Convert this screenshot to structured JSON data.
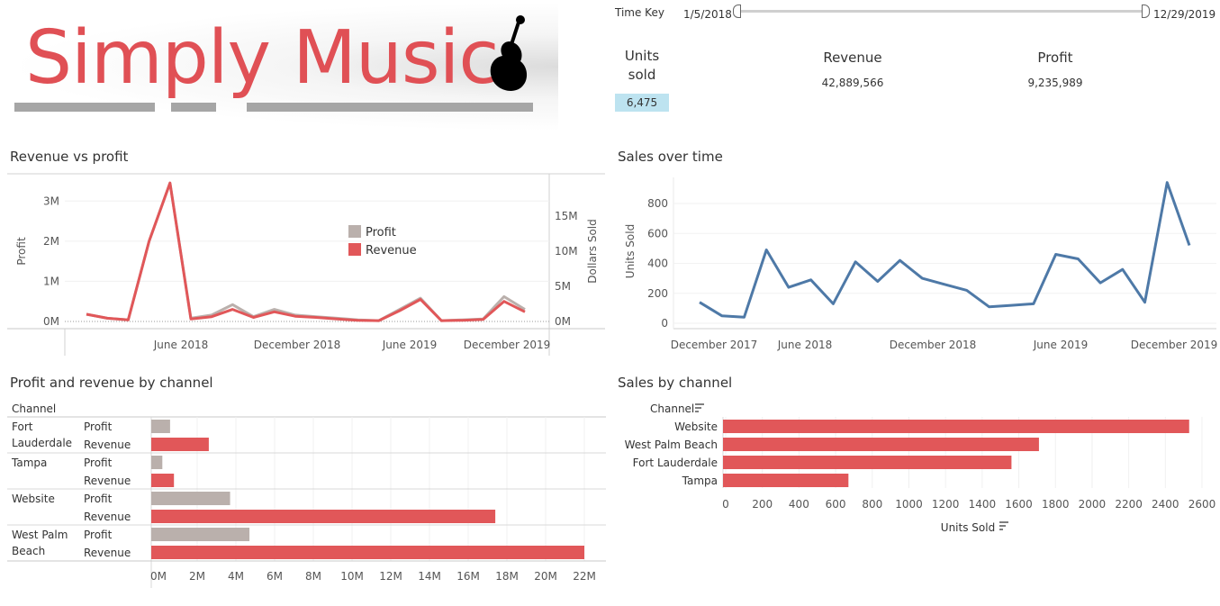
{
  "logo": {
    "text": "Simply Music",
    "icon": "violin-icon"
  },
  "time_filter": {
    "label": "Time Key",
    "start": "1/5/2018",
    "end": "12/29/2019"
  },
  "kpis": {
    "units": {
      "label_line1": "Units",
      "label_line2": "sold",
      "value": "6,475"
    },
    "revenue": {
      "label": "Revenue",
      "value": "42,889,566"
    },
    "profit": {
      "label": "Profit",
      "value": "9,235,989"
    }
  },
  "colors": {
    "revenue": "#e15759",
    "profit": "#bab0ac",
    "sales_line": "#4e79a7",
    "kpi_highlight": "#bde3f0"
  },
  "sheets": {
    "revenue_vs_profit": {
      "title": "Revenue vs profit"
    },
    "sales_over_time": {
      "title": "Sales over time"
    },
    "profit_revenue_by_channel": {
      "title": "Profit and revenue by channel"
    },
    "sales_by_channel": {
      "title": "Sales by channel"
    }
  },
  "chart_data": [
    {
      "type": "line",
      "title": "Revenue vs profit",
      "ylabel": "Profit",
      "y2label": "Dollars Sold",
      "yticks": [
        "0M",
        "1M",
        "2M",
        "3M"
      ],
      "y2ticks": [
        "0M",
        "5M",
        "10M",
        "15M"
      ],
      "xticks": [
        "June 2018",
        "December 2018",
        "June 2019",
        "December 2019"
      ],
      "ylim": [
        0,
        3.5
      ],
      "legend": {
        "position": "top-right",
        "entries": [
          "Profit",
          "Revenue"
        ]
      },
      "series": [
        {
          "name": "Profit",
          "values": [
            0.18,
            0.08,
            0.04,
            2.0,
            3.45,
            0.08,
            0.16,
            0.42,
            0.12,
            0.3,
            0.16,
            0.12,
            0.08,
            0.04,
            0.02,
            0.3,
            0.58,
            0.02,
            0.04,
            0.06,
            0.62,
            0.3
          ]
        },
        {
          "name": "Revenue",
          "values": [
            0.18,
            0.08,
            0.04,
            2.0,
            3.45,
            0.06,
            0.12,
            0.3,
            0.1,
            0.24,
            0.13,
            0.1,
            0.06,
            0.03,
            0.02,
            0.27,
            0.55,
            0.02,
            0.03,
            0.05,
            0.5,
            0.24
          ]
        }
      ]
    },
    {
      "type": "line",
      "title": "Sales over time",
      "ylabel": "Units Sold",
      "yticks": [
        "0",
        "200",
        "400",
        "600",
        "800"
      ],
      "xticks": [
        "December 2017",
        "June 2018",
        "December 2018",
        "June 2019",
        "December 2019"
      ],
      "ylim": [
        0,
        950
      ],
      "series": [
        {
          "name": "Units Sold",
          "values": [
            140,
            50,
            40,
            490,
            240,
            290,
            130,
            410,
            280,
            420,
            300,
            260,
            220,
            110,
            120,
            130,
            460,
            430,
            270,
            360,
            140,
            940,
            520
          ]
        }
      ]
    },
    {
      "type": "bar",
      "title": "Profit and revenue by channel",
      "channel_header": "Channel",
      "xticks": [
        "0M",
        "2M",
        "4M",
        "6M",
        "8M",
        "10M",
        "12M",
        "14M",
        "16M",
        "18M",
        "20M",
        "22M"
      ],
      "xlim": [
        0,
        22
      ],
      "rows": [
        {
          "channel_line1": "Fort",
          "channel_line2": "Lauderdale",
          "profit": 0.6,
          "revenue": 2.6
        },
        {
          "channel_line1": "Tampa",
          "channel_line2": "",
          "profit": 0.2,
          "revenue": 0.8
        },
        {
          "channel_line1": "Website",
          "channel_line2": "",
          "profit": 3.7,
          "revenue": 17.4
        },
        {
          "channel_line1": "West Palm",
          "channel_line2": "Beach",
          "profit": 4.7,
          "revenue": 22.0
        }
      ],
      "measure_labels": {
        "profit": "Profit",
        "revenue": "Revenue"
      }
    },
    {
      "type": "bar",
      "title": "Sales by channel",
      "channel_header": "Channel",
      "xlabel": "Units Sold",
      "xticks": [
        "0",
        "200",
        "400",
        "600",
        "800",
        "1000",
        "1200",
        "1400",
        "1600",
        "1800",
        "2000",
        "2200",
        "2400",
        "2600"
      ],
      "xlim": [
        0,
        2600
      ],
      "categories": [
        "Website",
        "West Palm Beach",
        "Fort Lauderdale",
        "Tampa"
      ],
      "values": [
        2530,
        1710,
        1560,
        670
      ]
    }
  ]
}
